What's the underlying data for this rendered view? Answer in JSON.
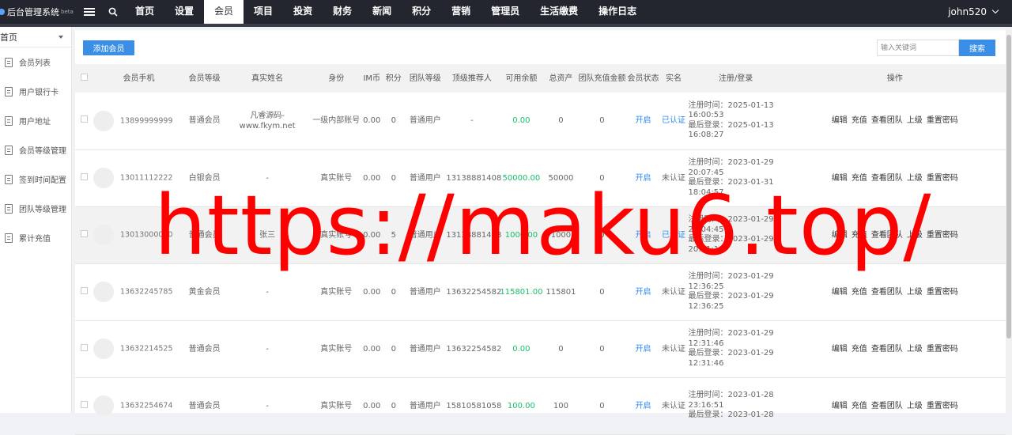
{
  "app": {
    "title": "后台管理系统",
    "beta": "beta"
  },
  "nav": [
    {
      "label": "首页",
      "active": false
    },
    {
      "label": "设置",
      "active": false
    },
    {
      "label": "会员",
      "active": true
    },
    {
      "label": "项目",
      "active": false
    },
    {
      "label": "投资",
      "active": false
    },
    {
      "label": "财务",
      "active": false
    },
    {
      "label": "新闻",
      "active": false
    },
    {
      "label": "积分",
      "active": false
    },
    {
      "label": "营销",
      "active": false
    },
    {
      "label": "管理员",
      "active": false
    },
    {
      "label": "生活缴费",
      "active": false
    },
    {
      "label": "操作日志",
      "active": false
    }
  ],
  "user": {
    "name": "john520"
  },
  "sidebar": {
    "select_label": "首页",
    "items": [
      "会员列表",
      "用户银行卡",
      "用户地址",
      "会员等级管理",
      "签到时间配置",
      "团队等级管理",
      "累计充值"
    ]
  },
  "toolbar": {
    "add_label": "添加会员",
    "search_placeholder": "输入关键词",
    "search_label": "搜索"
  },
  "table": {
    "headers": [
      "会员手机",
      "会员等级",
      "真实姓名",
      "身份",
      "IM币",
      "积分",
      "团队等级",
      "顶级推荐人",
      "可用余额",
      "总资产",
      "团队充值金额",
      "会员状态",
      "实名",
      "注册/登录",
      "操作"
    ],
    "actions": [
      "编辑",
      "充值",
      "查看团队",
      "上级",
      "重置密码"
    ],
    "rows": [
      {
        "phone": "13899999999",
        "level": "普通会员",
        "name": "凡睿源码-www.fkym.net",
        "identity": "一级内部账号",
        "im": "0.00",
        "points": "0",
        "team": "普通用户",
        "referrer": "-",
        "balance": "0.00",
        "assets": "0",
        "team_recharge": "0",
        "status": "开启",
        "realname": "已认证",
        "verified": true,
        "reg": "注册时间：2025-01-13 16:00:53",
        "login": "最后登录：2025-01-13 16:08:27"
      },
      {
        "phone": "13011112222",
        "level": "白银会员",
        "name": "-",
        "identity": "真实账号",
        "im": "0.00",
        "points": "0",
        "team": "普通用户",
        "referrer": "13138881408",
        "balance": "50000.00",
        "assets": "50000",
        "team_recharge": "0",
        "status": "开启",
        "realname": "未认证",
        "verified": false,
        "reg": "注册时间：2023-01-29 20:07:45",
        "login": "最后登录：2023-01-31 18:04:57"
      },
      {
        "phone": "13013000000",
        "level": "普通会员",
        "name": "张三",
        "identity": "真实账号",
        "im": "0.00",
        "points": "5",
        "team": "普通用户",
        "referrer": "13138881408",
        "balance": "1000.00",
        "assets": "1000",
        "team_recharge": "0",
        "status": "开启",
        "realname": "已认证",
        "verified": true,
        "reg": "注册时间：2023-01-29 20:04:45",
        "login": "最后登录：2023-01-29 20:01:10"
      },
      {
        "phone": "13632245785",
        "level": "黄金会员",
        "name": "-",
        "identity": "真实账号",
        "im": "0.00",
        "points": "0",
        "team": "普通用户",
        "referrer": "13632254582",
        "balance": "115801.00",
        "assets": "115801",
        "team_recharge": "0",
        "status": "开启",
        "realname": "未认证",
        "verified": false,
        "reg": "注册时间：2023-01-29 12:36:25",
        "login": "最后登录：2023-01-29 12:36:25"
      },
      {
        "phone": "13632214525",
        "level": "普通会员",
        "name": "-",
        "identity": "真实账号",
        "im": "0.00",
        "points": "0",
        "team": "普通用户",
        "referrer": "13632254582",
        "balance": "0.00",
        "assets": "0",
        "team_recharge": "0",
        "status": "开启",
        "realname": "未认证",
        "verified": false,
        "reg": "注册时间：2023-01-29 12:31:46",
        "login": "最后登录：2023-01-29 12:31:46"
      },
      {
        "phone": "13632254674",
        "level": "普通会员",
        "name": "-",
        "identity": "真实账号",
        "im": "0.00",
        "points": "0",
        "team": "普通用户",
        "referrer": "15810581058",
        "balance": "100.00",
        "assets": "100",
        "team_recharge": "0",
        "status": "开启",
        "realname": "未认证",
        "verified": false,
        "reg": "注册时间：2023-01-28 23:16:51",
        "login": "最后登录：2023-01-28"
      }
    ]
  },
  "watermark": "https://maku6.top/",
  "colors": {
    "topbar": "#23262e",
    "accent": "#3a8ee6",
    "green": "#19be6b",
    "blue": "#2d8cf0",
    "watermark": "#ff0000"
  }
}
